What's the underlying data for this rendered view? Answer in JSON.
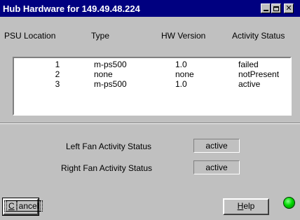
{
  "window": {
    "title": "Hub Hardware for 149.49.48.224",
    "minimize_icon": "minimize-icon",
    "maximize_icon": "maximize-icon",
    "close_icon": "close-icon",
    "close_glyph": "✕"
  },
  "psu_table": {
    "headers": {
      "location": "PSU Location",
      "type": "Type",
      "hw_version": "HW Version",
      "activity": "Activity Status"
    },
    "rows": [
      {
        "location": "1",
        "type": "m-ps500",
        "hw_version": "1.0",
        "activity": "failed"
      },
      {
        "location": "2",
        "type": "none",
        "hw_version": "none",
        "activity": "notPresent"
      },
      {
        "location": "3",
        "type": "m-ps500",
        "hw_version": "1.0",
        "activity": "active"
      }
    ]
  },
  "fans": {
    "left_label": "Left Fan  Activity Status",
    "left_value": "active",
    "right_label": "Right Fan  Activity Status",
    "right_value": "active"
  },
  "buttons": {
    "cancel_mnemonic": "C",
    "cancel_rest": "ancel",
    "help_mnemonic": "H",
    "help_rest": "elp"
  },
  "status_indicator": {
    "color": "#00d800",
    "icon": "status-led-icon"
  }
}
